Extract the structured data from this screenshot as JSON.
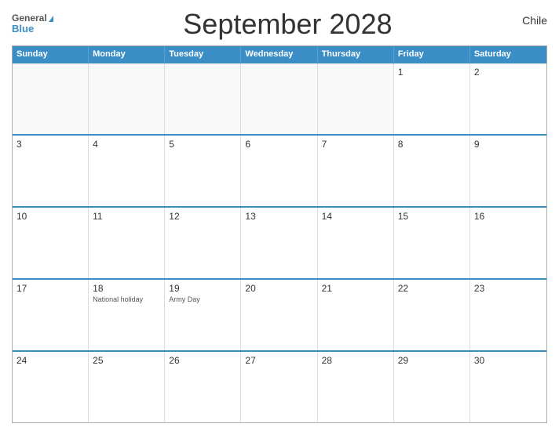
{
  "header": {
    "title": "September 2028",
    "country": "Chile",
    "logo_general": "General",
    "logo_blue": "Blue"
  },
  "days_of_week": [
    "Sunday",
    "Monday",
    "Tuesday",
    "Wednesday",
    "Thursday",
    "Friday",
    "Saturday"
  ],
  "weeks": [
    [
      {
        "day": "",
        "empty": true
      },
      {
        "day": "",
        "empty": true
      },
      {
        "day": "",
        "empty": true
      },
      {
        "day": "",
        "empty": true
      },
      {
        "day": "",
        "empty": true
      },
      {
        "day": "1",
        "empty": false
      },
      {
        "day": "2",
        "empty": false
      }
    ],
    [
      {
        "day": "3",
        "empty": false
      },
      {
        "day": "4",
        "empty": false
      },
      {
        "day": "5",
        "empty": false
      },
      {
        "day": "6",
        "empty": false
      },
      {
        "day": "7",
        "empty": false
      },
      {
        "day": "8",
        "empty": false
      },
      {
        "day": "9",
        "empty": false
      }
    ],
    [
      {
        "day": "10",
        "empty": false
      },
      {
        "day": "11",
        "empty": false
      },
      {
        "day": "12",
        "empty": false
      },
      {
        "day": "13",
        "empty": false
      },
      {
        "day": "14",
        "empty": false
      },
      {
        "day": "15",
        "empty": false
      },
      {
        "day": "16",
        "empty": false
      }
    ],
    [
      {
        "day": "17",
        "empty": false
      },
      {
        "day": "18",
        "empty": false,
        "holiday": "National holiday"
      },
      {
        "day": "19",
        "empty": false,
        "holiday": "Army Day"
      },
      {
        "day": "20",
        "empty": false
      },
      {
        "day": "21",
        "empty": false
      },
      {
        "day": "22",
        "empty": false
      },
      {
        "day": "23",
        "empty": false
      }
    ],
    [
      {
        "day": "24",
        "empty": false
      },
      {
        "day": "25",
        "empty": false
      },
      {
        "day": "26",
        "empty": false
      },
      {
        "day": "27",
        "empty": false
      },
      {
        "day": "28",
        "empty": false
      },
      {
        "day": "29",
        "empty": false
      },
      {
        "day": "30",
        "empty": false
      }
    ]
  ]
}
